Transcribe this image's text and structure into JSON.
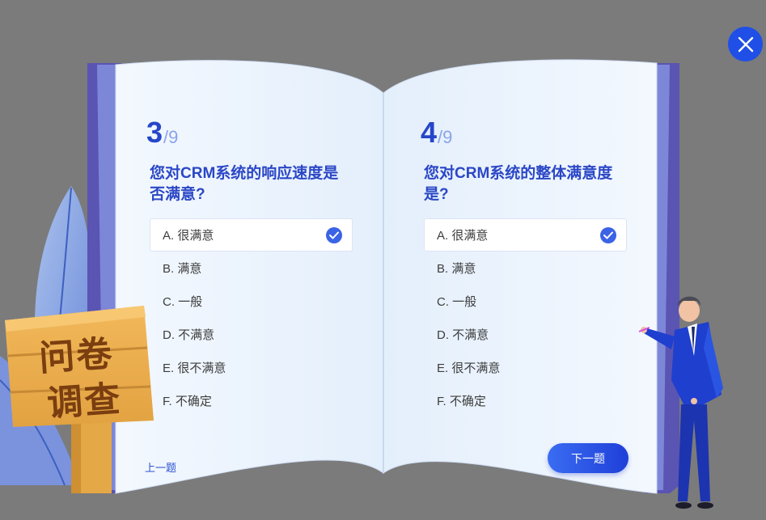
{
  "left_page": {
    "number": "3",
    "total": "/9",
    "question": "您对CRM系统的响应速度是否满意?",
    "options": [
      {
        "label": "A. 很满意",
        "selected": true
      },
      {
        "label": "B. 满意",
        "selected": false
      },
      {
        "label": "C. 一般",
        "selected": false
      },
      {
        "label": "D. 不满意",
        "selected": false
      },
      {
        "label": "E. 很不满意",
        "selected": false
      },
      {
        "label": "F. 不确定",
        "selected": false
      }
    ],
    "prev_label": "上一题"
  },
  "right_page": {
    "number": "4",
    "total": "/9",
    "question": "您对CRM系统的整体满意度是?",
    "options": [
      {
        "label": "A. 很满意",
        "selected": true
      },
      {
        "label": "B. 满意",
        "selected": false
      },
      {
        "label": "C. 一般",
        "selected": false
      },
      {
        "label": "D. 不满意",
        "selected": false
      },
      {
        "label": "E. 很不满意",
        "selected": false
      },
      {
        "label": "F. 不确定",
        "selected": false
      }
    ],
    "next_label": "下一题"
  },
  "sign": {
    "line1": "问卷",
    "line2": "调查"
  },
  "icons": {
    "close": "close-icon",
    "check": "check-icon"
  },
  "colors": {
    "backdrop": "#7b7b7b",
    "accent": "#2646c9",
    "button": "#2f55e4",
    "book_cover": "#5b55b3",
    "page": "#eef5fd"
  }
}
